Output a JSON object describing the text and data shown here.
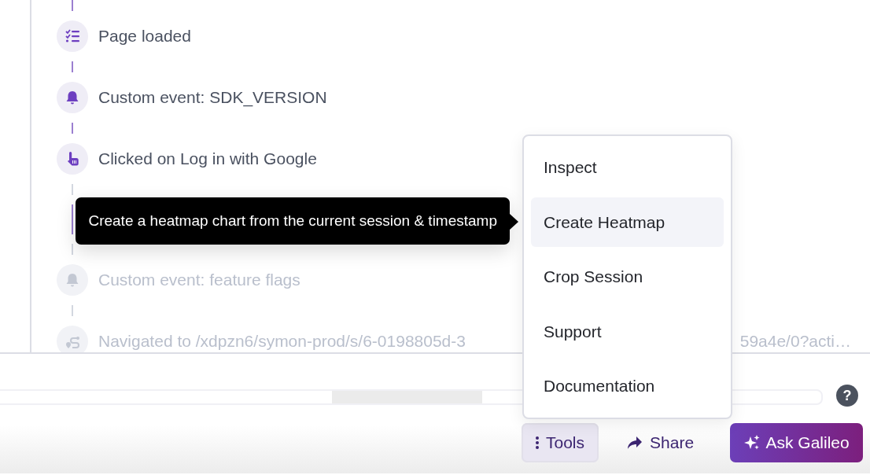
{
  "events": [
    {
      "kind": "checklist",
      "text": "Page loaded",
      "faded": false
    },
    {
      "kind": "bell",
      "text": "Custom event: SDK_VERSION",
      "faded": false
    },
    {
      "kind": "pointer",
      "text": "Clicked on Log in with Google",
      "faded": false
    },
    {
      "kind": "bell",
      "text": "Custom event: feature flags",
      "faded": true
    },
    {
      "kind": "route",
      "text": "Navigated to /xdpzn6/symon-prod/s/6-0198805d-3",
      "text_end": "59a4e/0?acti…",
      "faded": true
    }
  ],
  "tooltip": {
    "text": "Create a heatmap chart from the current session & timestamp"
  },
  "tools_menu": {
    "items": [
      {
        "label": "Inspect",
        "selected": false
      },
      {
        "label": "Create Heatmap",
        "selected": true
      },
      {
        "label": "Crop Session",
        "selected": false
      },
      {
        "label": "Support",
        "selected": false
      },
      {
        "label": "Documentation",
        "selected": false
      }
    ]
  },
  "help": {
    "label": "?"
  },
  "toolbar": {
    "tools": {
      "label": "Tools",
      "expanded": true
    },
    "share": {
      "label": "Share"
    },
    "ask": {
      "label": "Ask Galileo"
    }
  }
}
